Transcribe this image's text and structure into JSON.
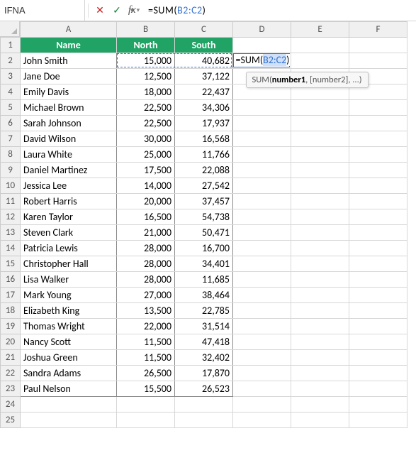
{
  "formula_bar": {
    "name_box": "IFNA",
    "formula_prefix": "=SUM(",
    "formula_ref": "B2:C2",
    "formula_suffix": ")"
  },
  "columns": [
    "A",
    "B",
    "C",
    "D",
    "E",
    "F"
  ],
  "headers": {
    "name": "Name",
    "north": "North",
    "south": "South"
  },
  "rows": [
    {
      "n": "1"
    },
    {
      "n": "2",
      "name": "John Smith",
      "north": "15,000",
      "south": "40,682"
    },
    {
      "n": "3",
      "name": "Jane Doe",
      "north": "12,500",
      "south": "37,122"
    },
    {
      "n": "4",
      "name": "Emily Davis",
      "north": "18,000",
      "south": "22,437"
    },
    {
      "n": "5",
      "name": "Michael Brown",
      "north": "22,500",
      "south": "34,306"
    },
    {
      "n": "6",
      "name": "Sarah Johnson",
      "north": "22,500",
      "south": "17,937"
    },
    {
      "n": "7",
      "name": "David Wilson",
      "north": "30,000",
      "south": "16,568"
    },
    {
      "n": "8",
      "name": "Laura White",
      "north": "25,000",
      "south": "11,766"
    },
    {
      "n": "9",
      "name": "Daniel Martinez",
      "north": "17,500",
      "south": "22,088"
    },
    {
      "n": "10",
      "name": "Jessica Lee",
      "north": "14,000",
      "south": "27,542"
    },
    {
      "n": "11",
      "name": "Robert Harris",
      "north": "20,000",
      "south": "37,457"
    },
    {
      "n": "12",
      "name": "Karen Taylor",
      "north": "16,500",
      "south": "54,738"
    },
    {
      "n": "13",
      "name": "Steven Clark",
      "north": "21,000",
      "south": "50,471"
    },
    {
      "n": "14",
      "name": "Patricia Lewis",
      "north": "28,000",
      "south": "16,700"
    },
    {
      "n": "15",
      "name": "Christopher Hall",
      "north": "28,000",
      "south": "34,401"
    },
    {
      "n": "16",
      "name": "Lisa Walker",
      "north": "28,000",
      "south": "11,685"
    },
    {
      "n": "17",
      "name": "Mark Young",
      "north": "27,000",
      "south": "38,464"
    },
    {
      "n": "18",
      "name": "Elizabeth King",
      "north": "13,500",
      "south": "22,785"
    },
    {
      "n": "19",
      "name": "Thomas Wright",
      "north": "22,000",
      "south": "31,514"
    },
    {
      "n": "20",
      "name": "Nancy Scott",
      "north": "11,500",
      "south": "47,418"
    },
    {
      "n": "21",
      "name": "Joshua Green",
      "north": "11,500",
      "south": "32,402"
    },
    {
      "n": "22",
      "name": "Sandra Adams",
      "north": "26,500",
      "south": "17,870"
    },
    {
      "n": "23",
      "name": "Paul Nelson",
      "north": "15,500",
      "south": "26,523"
    },
    {
      "n": "24"
    },
    {
      "n": "25"
    }
  ],
  "editing": {
    "cell_prefix": "=SUM(",
    "cell_ref": "B2:C2",
    "cell_suffix": ")",
    "tooltip_fn": "SUM(",
    "tooltip_b": "number1",
    "tooltip_rest": ", [number2], ...)"
  },
  "chart_data": {
    "type": "table",
    "columns": [
      "Name",
      "North",
      "South"
    ],
    "rows": [
      [
        "John Smith",
        15000,
        40682
      ],
      [
        "Jane Doe",
        12500,
        37122
      ],
      [
        "Emily Davis",
        18000,
        22437
      ],
      [
        "Michael Brown",
        22500,
        34306
      ],
      [
        "Sarah Johnson",
        22500,
        17937
      ],
      [
        "David Wilson",
        30000,
        16568
      ],
      [
        "Laura White",
        25000,
        11766
      ],
      [
        "Daniel Martinez",
        17500,
        22088
      ],
      [
        "Jessica Lee",
        14000,
        27542
      ],
      [
        "Robert Harris",
        20000,
        37457
      ],
      [
        "Karen Taylor",
        16500,
        54738
      ],
      [
        "Steven Clark",
        21000,
        50471
      ],
      [
        "Patricia Lewis",
        28000,
        16700
      ],
      [
        "Christopher Hall",
        28000,
        34401
      ],
      [
        "Lisa Walker",
        28000,
        11685
      ],
      [
        "Mark Young",
        27000,
        38464
      ],
      [
        "Elizabeth King",
        13500,
        22785
      ],
      [
        "Thomas Wright",
        22000,
        31514
      ],
      [
        "Nancy Scott",
        11500,
        47418
      ],
      [
        "Joshua Green",
        11500,
        32402
      ],
      [
        "Sandra Adams",
        26500,
        17870
      ],
      [
        "Paul Nelson",
        15500,
        26523
      ]
    ]
  }
}
